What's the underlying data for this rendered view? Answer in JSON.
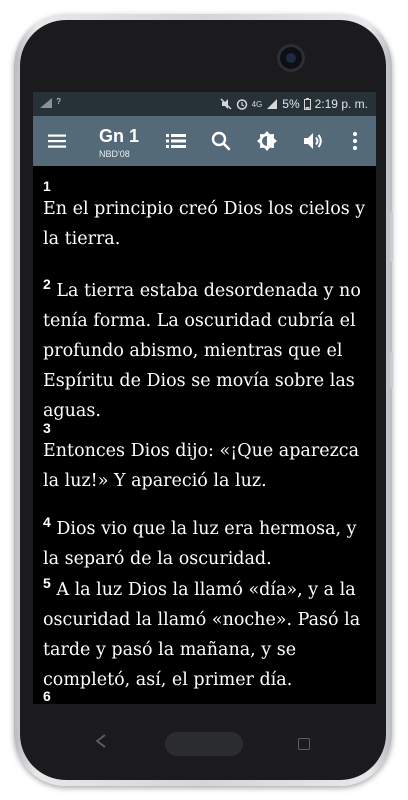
{
  "status_bar": {
    "signal_left": "?",
    "battery": "5%",
    "network": "4G",
    "time": "2:19 p. m."
  },
  "app_bar": {
    "title": "Gn 1",
    "subtitle": "NBD'08",
    "icons": [
      "menu-icon",
      "list-icon",
      "search-icon",
      "brightness-icon",
      "volume-icon",
      "more-vert-icon"
    ],
    "background": "#556a79"
  },
  "verses": [
    {
      "num": "1",
      "text": "En el principio creó Dios los cielos y la tierra."
    },
    {
      "num": "2",
      "text": "La tierra estaba desordenada y no tenía forma. La oscuridad cubría el profundo abismo, mientras que el Espíritu de Dios se movía sobre las aguas."
    },
    {
      "num": "3",
      "text": "Entonces Dios dijo: «¡Que aparezca la luz!» Y apareció la luz."
    },
    {
      "num": "4",
      "text": "Dios vio que la luz era hermosa, y la separó de la oscuridad."
    },
    {
      "num": "5",
      "text": "A la luz Dios la llamó «día», y a la oscuridad la llamó «noche». Pasó la tarde y pasó la mañana, y se completó, así, el primer día."
    },
    {
      "num": "6",
      "text": ""
    }
  ],
  "colors": {
    "status_bar": "#263238",
    "reader_background": "#000000",
    "reader_text": "#ffffff"
  }
}
